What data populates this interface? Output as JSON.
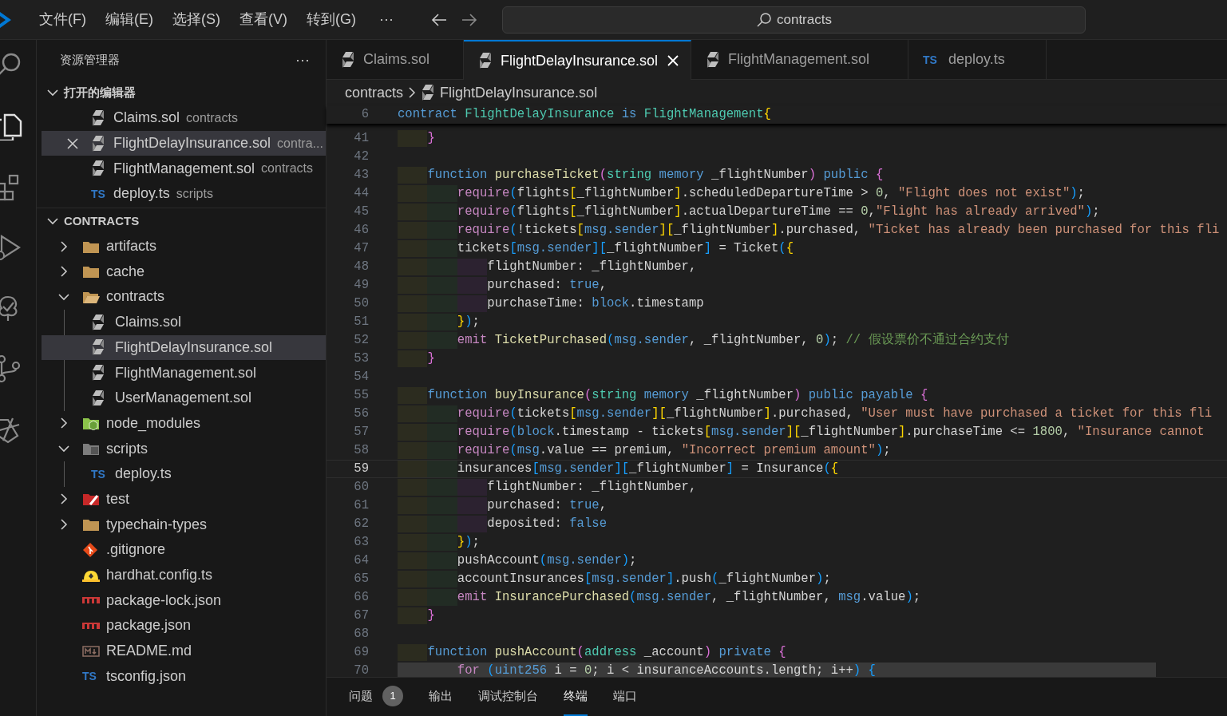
{
  "menu": [
    "文件(F)",
    "编辑(E)",
    "选择(S)",
    "查看(V)",
    "转到(G)"
  ],
  "menu_more": "···",
  "search": {
    "value": "contracts"
  },
  "activity_bar": [
    {
      "kind": "search",
      "selected": false
    },
    {
      "kind": "explorer",
      "selected": true
    },
    {
      "kind": "extensions",
      "selected": false
    },
    {
      "kind": "run",
      "selected": false
    },
    {
      "kind": "testing",
      "selected": false
    },
    {
      "kind": "source-control",
      "selected": false
    },
    {
      "kind": "remote",
      "selected": false
    }
  ],
  "sidebar": {
    "title": "资源管理器",
    "more": "···",
    "open_editors": {
      "title": "打开的编辑器",
      "expanded": true,
      "items": [
        {
          "label": "Claims.sol",
          "detail": "contracts",
          "kind": "sol",
          "selected": false
        },
        {
          "label": "FlightDelayInsurance.sol",
          "detail": "contra...",
          "kind": "sol",
          "selected": true
        },
        {
          "label": "FlightManagement.sol",
          "detail": "contracts",
          "kind": "sol",
          "selected": false
        },
        {
          "label": "deploy.ts",
          "detail": "scripts",
          "kind": "ts",
          "icon_text": "TS",
          "selected": false
        }
      ]
    },
    "folder": {
      "title": "CONTRACTS",
      "expanded": true,
      "items": [
        {
          "label": "artifacts",
          "kind": "folder",
          "expanded": false,
          "selected": false
        },
        {
          "label": "cache",
          "kind": "folder",
          "expanded": false,
          "selected": false
        },
        {
          "label": "contracts",
          "kind": "folder",
          "expanded": true,
          "selected": false,
          "children": [
            {
              "label": "Claims.sol",
              "kind": "sol",
              "selected": false
            },
            {
              "label": "FlightDelayInsurance.sol",
              "kind": "sol",
              "selected": true
            },
            {
              "label": "FlightManagement.sol",
              "kind": "sol",
              "selected": false
            },
            {
              "label": "UserManagement.sol",
              "kind": "sol",
              "selected": false
            }
          ]
        },
        {
          "label": "node_modules",
          "kind": "node",
          "expanded": false,
          "selected": false
        },
        {
          "label": "scripts",
          "kind": "scripts",
          "expanded": true,
          "selected": false,
          "children": [
            {
              "label": "deploy.ts",
              "kind": "ts",
              "icon_text": "TS",
              "selected": false
            }
          ]
        },
        {
          "label": "test",
          "kind": "test",
          "expanded": false,
          "selected": false
        },
        {
          "label": "typechain-types",
          "kind": "folder",
          "expanded": false,
          "selected": false
        },
        {
          "label": ".gitignore",
          "kind": "git",
          "selected": false
        },
        {
          "label": "hardhat.config.ts",
          "kind": "hardhat",
          "selected": false
        },
        {
          "label": "package-lock.json",
          "kind": "npm",
          "selected": false
        },
        {
          "label": "package.json",
          "kind": "npm",
          "selected": false
        },
        {
          "label": "README.md",
          "kind": "md",
          "selected": false
        },
        {
          "label": "tsconfig.json",
          "kind": "tsconfig",
          "icon_text": "TS",
          "selected": false
        }
      ]
    }
  },
  "tabs": [
    {
      "label": "Claims.sol",
      "kind": "sol",
      "selected": false
    },
    {
      "label": "FlightDelayInsurance.sol",
      "kind": "sol",
      "selected": true
    },
    {
      "label": "FlightManagement.sol",
      "kind": "sol",
      "selected": false
    },
    {
      "label": "deploy.ts",
      "kind": "ts",
      "icon_text": "TS",
      "selected": false
    }
  ],
  "breadcrumb": {
    "folder": "contracts",
    "file": "FlightDelayInsurance.sol"
  },
  "sticky_line": {
    "number": "6",
    "tokens": [
      {
        "text": "contract ",
        "kind": "keyword"
      },
      {
        "text": "FlightDelayInsurance ",
        "kind": "type"
      },
      {
        "text": "is ",
        "kind": "keyword"
      },
      {
        "text": "FlightManagement",
        "kind": "type"
      },
      {
        "text": "{",
        "kind": "bracket-gold"
      }
    ]
  },
  "lines": [
    {
      "number": "41",
      "current": false,
      "highlighted": false,
      "tokens": [
        {
          "text": "    }",
          "kind": "bracket-pink"
        }
      ]
    },
    {
      "number": "42",
      "current": false,
      "highlighted": false
    },
    {
      "number": "43",
      "current": false,
      "highlighted": false,
      "tokens": [
        {
          "text": "    function ",
          "kind": "keyword"
        },
        {
          "text": "purchaseTicket",
          "kind": "function"
        },
        {
          "text": "(",
          "kind": "bracket-pink"
        },
        {
          "text": "string ",
          "kind": "type"
        },
        {
          "text": "memory",
          "kind": "keyword"
        },
        {
          "text": " _flightNumber",
          "kind": "plain"
        },
        {
          "text": ")",
          "kind": "bracket-pink"
        },
        {
          "text": " public ",
          "kind": "keyword"
        },
        {
          "text": "{",
          "kind": "bracket-pink"
        }
      ]
    },
    {
      "number": "44",
      "current": false,
      "highlighted": false,
      "tokens": [
        {
          "text": "        require",
          "kind": "control"
        },
        {
          "text": "(",
          "kind": "bracket-blue"
        },
        {
          "text": "flights",
          "kind": "plain"
        },
        {
          "text": "[",
          "kind": "bracket-gold"
        },
        {
          "text": "_flightNumber",
          "kind": "plain"
        },
        {
          "text": "]",
          "kind": "bracket-gold"
        },
        {
          "text": ".scheduledDepartureTime > ",
          "kind": "plain"
        },
        {
          "text": "0",
          "kind": "number"
        },
        {
          "text": ", ",
          "kind": "plain"
        },
        {
          "text": "\"Flight does not exist\"",
          "kind": "string"
        },
        {
          "text": ")",
          "kind": "bracket-blue"
        },
        {
          "text": ";",
          "kind": "plain"
        }
      ]
    },
    {
      "number": "45",
      "current": false,
      "highlighted": false,
      "tokens": [
        {
          "text": "        require",
          "kind": "control"
        },
        {
          "text": "(",
          "kind": "bracket-blue"
        },
        {
          "text": "flights",
          "kind": "plain"
        },
        {
          "text": "[",
          "kind": "bracket-gold"
        },
        {
          "text": "_flightNumber",
          "kind": "plain"
        },
        {
          "text": "]",
          "kind": "bracket-gold"
        },
        {
          "text": ".actualDepartureTime == ",
          "kind": "plain"
        },
        {
          "text": "0",
          "kind": "number"
        },
        {
          "text": ",",
          "kind": "plain"
        },
        {
          "text": "\"Flight has already arrived\"",
          "kind": "string"
        },
        {
          "text": ")",
          "kind": "bracket-blue"
        },
        {
          "text": ";",
          "kind": "plain"
        }
      ]
    },
    {
      "number": "46",
      "current": false,
      "highlighted": false,
      "tokens": [
        {
          "text": "        require",
          "kind": "control"
        },
        {
          "text": "(",
          "kind": "bracket-blue"
        },
        {
          "text": "!tickets",
          "kind": "plain"
        },
        {
          "text": "[",
          "kind": "bracket-gold"
        },
        {
          "text": "msg.sender",
          "kind": "keyword"
        },
        {
          "text": "][",
          "kind": "bracket-gold"
        },
        {
          "text": "_flightNumber",
          "kind": "plain"
        },
        {
          "text": "]",
          "kind": "bracket-gold"
        },
        {
          "text": ".purchased, ",
          "kind": "plain"
        },
        {
          "text": "\"Ticket has already been purchased for this fli",
          "kind": "string"
        }
      ]
    },
    {
      "number": "47",
      "current": false,
      "highlighted": false,
      "tokens": [
        {
          "text": "        tickets",
          "kind": "plain"
        },
        {
          "text": "[",
          "kind": "bracket-blue"
        },
        {
          "text": "msg.sender",
          "kind": "keyword"
        },
        {
          "text": "][",
          "kind": "bracket-blue"
        },
        {
          "text": "_flightNumber",
          "kind": "plain"
        },
        {
          "text": "]",
          "kind": "bracket-blue"
        },
        {
          "text": " = Ticket",
          "kind": "plain"
        },
        {
          "text": "(",
          "kind": "bracket-blue"
        },
        {
          "text": "{",
          "kind": "bracket-gold"
        }
      ]
    },
    {
      "number": "48",
      "current": false,
      "highlighted": false,
      "tokens": [
        {
          "text": "            flightNumber: _flightNumber,",
          "kind": "plain"
        }
      ]
    },
    {
      "number": "49",
      "current": false,
      "highlighted": false,
      "tokens": [
        {
          "text": "            purchased: ",
          "kind": "plain"
        },
        {
          "text": "true",
          "kind": "keyword"
        },
        {
          "text": ",",
          "kind": "plain"
        }
      ]
    },
    {
      "number": "50",
      "current": false,
      "highlighted": false,
      "tokens": [
        {
          "text": "            purchaseTime: ",
          "kind": "plain"
        },
        {
          "text": "block",
          "kind": "keyword"
        },
        {
          "text": ".timestamp",
          "kind": "plain"
        }
      ]
    },
    {
      "number": "51",
      "current": false,
      "highlighted": false,
      "tokens": [
        {
          "text": "        }",
          "kind": "bracket-gold"
        },
        {
          "text": ")",
          "kind": "bracket-blue"
        },
        {
          "text": ";",
          "kind": "plain"
        }
      ]
    },
    {
      "number": "52",
      "current": false,
      "highlighted": false,
      "tokens": [
        {
          "text": "        emit ",
          "kind": "control"
        },
        {
          "text": "TicketPurchased",
          "kind": "function"
        },
        {
          "text": "(",
          "kind": "bracket-blue"
        },
        {
          "text": "msg.sender",
          "kind": "keyword"
        },
        {
          "text": ", _flightNumber, ",
          "kind": "plain"
        },
        {
          "text": "0",
          "kind": "number"
        },
        {
          "text": ")",
          "kind": "bracket-blue"
        },
        {
          "text": "; ",
          "kind": "plain"
        },
        {
          "text": "// 假设票价不通过合约支付",
          "kind": "comment"
        }
      ]
    },
    {
      "number": "53",
      "current": false,
      "highlighted": false,
      "tokens": [
        {
          "text": "    }",
          "kind": "bracket-pink"
        }
      ]
    },
    {
      "number": "54",
      "current": false,
      "highlighted": false
    },
    {
      "number": "55",
      "current": false,
      "highlighted": false,
      "tokens": [
        {
          "text": "    function ",
          "kind": "keyword"
        },
        {
          "text": "buyInsurance",
          "kind": "function"
        },
        {
          "text": "(",
          "kind": "bracket-pink"
        },
        {
          "text": "string ",
          "kind": "type"
        },
        {
          "text": "memory",
          "kind": "keyword"
        },
        {
          "text": " _flightNumber",
          "kind": "plain"
        },
        {
          "text": ")",
          "kind": "bracket-pink"
        },
        {
          "text": " public payable ",
          "kind": "keyword"
        },
        {
          "text": "{",
          "kind": "bracket-pink"
        }
      ]
    },
    {
      "number": "56",
      "current": false,
      "highlighted": false,
      "tokens": [
        {
          "text": "        require",
          "kind": "control"
        },
        {
          "text": "(",
          "kind": "bracket-blue"
        },
        {
          "text": "tickets",
          "kind": "plain"
        },
        {
          "text": "[",
          "kind": "bracket-gold"
        },
        {
          "text": "msg.sender",
          "kind": "keyword"
        },
        {
          "text": "][",
          "kind": "bracket-gold"
        },
        {
          "text": "_flightNumber",
          "kind": "plain"
        },
        {
          "text": "]",
          "kind": "bracket-gold"
        },
        {
          "text": ".purchased, ",
          "kind": "plain"
        },
        {
          "text": "\"User must have purchased a ticket for this fli",
          "kind": "string"
        }
      ]
    },
    {
      "number": "57",
      "current": false,
      "highlighted": false,
      "tokens": [
        {
          "text": "        require",
          "kind": "control"
        },
        {
          "text": "(",
          "kind": "bracket-blue"
        },
        {
          "text": "block",
          "kind": "keyword"
        },
        {
          "text": ".timestamp - tickets",
          "kind": "plain"
        },
        {
          "text": "[",
          "kind": "bracket-gold"
        },
        {
          "text": "msg.sender",
          "kind": "keyword"
        },
        {
          "text": "][",
          "kind": "bracket-gold"
        },
        {
          "text": "_flightNumber",
          "kind": "plain"
        },
        {
          "text": "]",
          "kind": "bracket-gold"
        },
        {
          "text": ".purchaseTime <= ",
          "kind": "plain"
        },
        {
          "text": "1800",
          "kind": "number"
        },
        {
          "text": ", ",
          "kind": "plain"
        },
        {
          "text": "\"Insurance cannot",
          "kind": "string"
        }
      ]
    },
    {
      "number": "58",
      "current": false,
      "highlighted": false,
      "tokens": [
        {
          "text": "        require",
          "kind": "control"
        },
        {
          "text": "(",
          "kind": "bracket-blue"
        },
        {
          "text": "msg",
          "kind": "keyword"
        },
        {
          "text": ".value == premium, ",
          "kind": "plain"
        },
        {
          "text": "\"Incorrect premium amount\"",
          "kind": "string"
        },
        {
          "text": ")",
          "kind": "bracket-blue"
        },
        {
          "text": ";",
          "kind": "plain"
        }
      ]
    },
    {
      "number": "59",
      "current": true,
      "highlighted": false,
      "tokens": [
        {
          "text": "        insurances",
          "kind": "plain"
        },
        {
          "text": "[",
          "kind": "bracket-blue"
        },
        {
          "text": "msg.sender",
          "kind": "keyword"
        },
        {
          "text": "][",
          "kind": "bracket-blue"
        },
        {
          "text": "_flightNumber",
          "kind": "plain"
        },
        {
          "text": "]",
          "kind": "bracket-blue"
        },
        {
          "text": " = Insurance",
          "kind": "plain"
        },
        {
          "text": "(",
          "kind": "bracket-blue"
        },
        {
          "text": "{",
          "kind": "bracket-gold"
        }
      ]
    },
    {
      "number": "60",
      "current": false,
      "highlighted": false,
      "tokens": [
        {
          "text": "            flightNumber: _flightNumber,",
          "kind": "plain"
        }
      ]
    },
    {
      "number": "61",
      "current": false,
      "highlighted": false,
      "tokens": [
        {
          "text": "            purchased: ",
          "kind": "plain"
        },
        {
          "text": "true",
          "kind": "keyword"
        },
        {
          "text": ",",
          "kind": "plain"
        }
      ]
    },
    {
      "number": "62",
      "current": false,
      "highlighted": false,
      "tokens": [
        {
          "text": "            deposited: ",
          "kind": "plain"
        },
        {
          "text": "false",
          "kind": "keyword"
        }
      ]
    },
    {
      "number": "63",
      "current": false,
      "highlighted": false,
      "tokens": [
        {
          "text": "        }",
          "kind": "bracket-gold"
        },
        {
          "text": ")",
          "kind": "bracket-blue"
        },
        {
          "text": ";",
          "kind": "plain"
        }
      ]
    },
    {
      "number": "64",
      "current": false,
      "highlighted": false,
      "tokens": [
        {
          "text": "        pushAccount",
          "kind": "plain"
        },
        {
          "text": "(",
          "kind": "bracket-blue"
        },
        {
          "text": "msg.sender",
          "kind": "keyword"
        },
        {
          "text": ")",
          "kind": "bracket-blue"
        },
        {
          "text": ";",
          "kind": "plain"
        }
      ]
    },
    {
      "number": "65",
      "current": false,
      "highlighted": false,
      "tokens": [
        {
          "text": "        accountInsurances",
          "kind": "plain"
        },
        {
          "text": "[",
          "kind": "bracket-blue"
        },
        {
          "text": "msg.sender",
          "kind": "keyword"
        },
        {
          "text": "]",
          "kind": "bracket-blue"
        },
        {
          "text": ".push",
          "kind": "plain"
        },
        {
          "text": "(",
          "kind": "bracket-blue"
        },
        {
          "text": "_flightNumber",
          "kind": "plain"
        },
        {
          "text": ")",
          "kind": "bracket-blue"
        },
        {
          "text": ";",
          "kind": "plain"
        }
      ]
    },
    {
      "number": "66",
      "current": false,
      "highlighted": false,
      "tokens": [
        {
          "text": "        emit ",
          "kind": "control"
        },
        {
          "text": "InsurancePurchased",
          "kind": "function"
        },
        {
          "text": "(",
          "kind": "bracket-blue"
        },
        {
          "text": "msg.sender",
          "kind": "keyword"
        },
        {
          "text": ", _flightNumber, ",
          "kind": "plain"
        },
        {
          "text": "msg",
          "kind": "keyword"
        },
        {
          "text": ".value",
          "kind": "plain"
        },
        {
          "text": ")",
          "kind": "bracket-blue"
        },
        {
          "text": ";",
          "kind": "plain"
        }
      ]
    },
    {
      "number": "67",
      "current": false,
      "highlighted": false,
      "tokens": [
        {
          "text": "    }",
          "kind": "bracket-pink"
        }
      ]
    },
    {
      "number": "68",
      "current": false,
      "highlighted": false
    },
    {
      "number": "69",
      "current": false,
      "highlighted": false,
      "tokens": [
        {
          "text": "    function ",
          "kind": "keyword"
        },
        {
          "text": "pushAccount",
          "kind": "function"
        },
        {
          "text": "(",
          "kind": "bracket-pink"
        },
        {
          "text": "address",
          "kind": "type"
        },
        {
          "text": " _account",
          "kind": "plain"
        },
        {
          "text": ")",
          "kind": "bracket-pink"
        },
        {
          "text": " private ",
          "kind": "keyword"
        },
        {
          "text": "{",
          "kind": "bracket-pink"
        }
      ]
    },
    {
      "number": "70",
      "current": false,
      "highlighted": true,
      "tokens": [
        {
          "text": "        for ",
          "kind": "control"
        },
        {
          "text": "(",
          "kind": "bracket-blue"
        },
        {
          "text": "uint256",
          "kind": "keyword"
        },
        {
          "text": " i = ",
          "kind": "plain"
        },
        {
          "text": "0",
          "kind": "number"
        },
        {
          "text": "; i < insuranceAccounts.length; i++",
          "kind": "plain"
        },
        {
          "text": ")",
          "kind": "bracket-blue"
        },
        {
          "text": " {",
          "kind": "bracket-blue"
        }
      ]
    }
  ],
  "panel": {
    "tabs": [
      {
        "label": "问题",
        "badge": "1",
        "selected": false
      },
      {
        "label": "输出",
        "selected": false
      },
      {
        "label": "调试控制台",
        "selected": false
      },
      {
        "label": "终端",
        "selected": true
      },
      {
        "label": "端口",
        "selected": false
      }
    ]
  }
}
